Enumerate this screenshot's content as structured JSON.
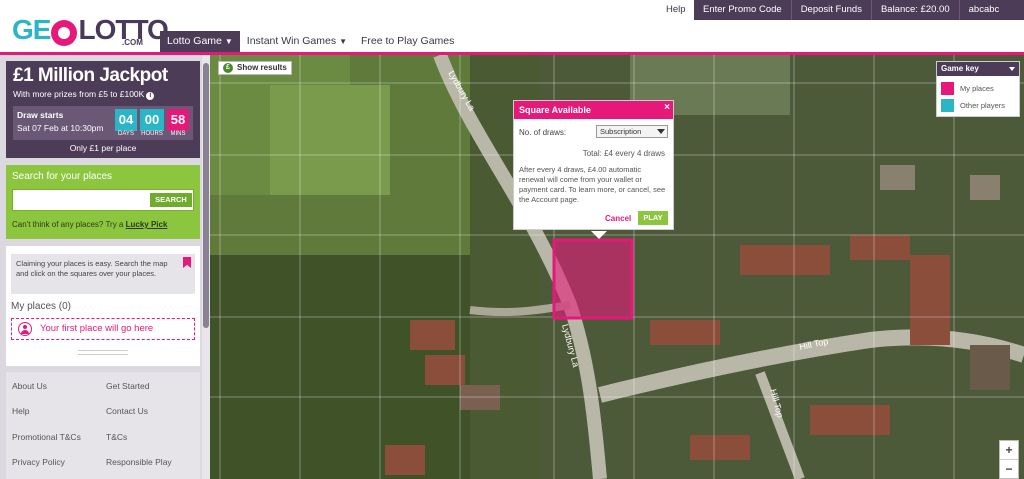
{
  "header": {
    "logo": {
      "geo": "GE",
      "lotto": "LOTTO",
      "com": ".COM"
    },
    "help": "Help",
    "top_links": [
      "Enter Promo Code",
      "Deposit Funds",
      "Balance: £20.00",
      "abcabc"
    ],
    "nav": [
      {
        "label": "Lotto Game",
        "active": true,
        "has_dropdown": true
      },
      {
        "label": "Instant Win Games",
        "active": false,
        "has_dropdown": true
      },
      {
        "label": "Free to Play Games",
        "active": false,
        "has_dropdown": false
      }
    ]
  },
  "jackpot": {
    "title": "£1 Million Jackpot",
    "subtitle": "With more prizes from £5 to £100K",
    "draw_label": "Draw starts",
    "draw_date": "Sat 07 Feb at 10:30pm",
    "countdown": [
      {
        "digits": "04",
        "unit": "DAYS",
        "color": "#2bb6c8"
      },
      {
        "digits": "00",
        "unit": "HOURS",
        "color": "#2bb6c8"
      },
      {
        "digits": "58",
        "unit": "MINS",
        "color": "#e6197a"
      }
    ],
    "footer": "Only £1 per place"
  },
  "search": {
    "title": "Search for your places",
    "input_value": "",
    "button": "SEARCH",
    "hint_prefix": "Can't think of any places? Try a",
    "hint_link": "Lucky Pick"
  },
  "places": {
    "note": "Claiming your places is easy. Search the map and click on the squares over your places.",
    "title": "My places (0)",
    "first_place": "Your first place will go here"
  },
  "links": [
    "About Us",
    "Get Started",
    "Help",
    "Contact Us",
    "Promotional T&Cs",
    "T&Cs",
    "Privacy Policy",
    "Responsible Play"
  ],
  "map": {
    "show_results": "Show results",
    "road_labels": [
      "Lydbury La",
      "Lydbury La",
      "Hill Top",
      "Hill Top"
    ],
    "popup": {
      "title": "Square Available",
      "close": "×",
      "draws_label": "No. of draws:",
      "draws_value": "Subscription",
      "total": "Total: £4 every 4 draws",
      "text": "After every 4 draws, £4.00 automatic renewal will come from your wallet or payment card. To learn more, or cancel, see the Account page.",
      "cancel": "Cancel",
      "play": "PLAY"
    },
    "game_key": {
      "title": "Game key",
      "items": [
        {
          "label": "My places",
          "color": "#e6197a"
        },
        {
          "label": "Other players",
          "color": "#2bb6c8"
        }
      ]
    },
    "zoom": {
      "in": "+",
      "out": "−"
    }
  },
  "colors": {
    "brand_purple": "#4d3c57",
    "brand_pink": "#e6197a",
    "brand_teal": "#2bb6c8",
    "brand_green": "#8cc63f"
  }
}
